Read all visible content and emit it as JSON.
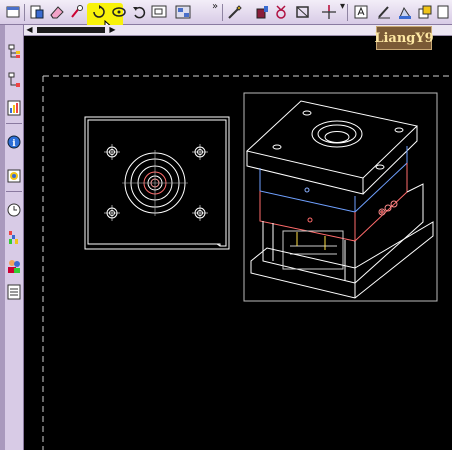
{
  "app": {
    "watermark_text": "LiangY9"
  },
  "toolbar": {
    "buttons": [
      {
        "icon": "new-file-icon"
      },
      {
        "icon": "open-file-icon"
      },
      {
        "icon": "erase-icon"
      },
      {
        "icon": "redraw-icon"
      },
      {
        "icon": "rotate-view-icon"
      },
      {
        "icon": "pan-view-icon"
      },
      {
        "icon": "undo-view-icon"
      },
      {
        "icon": "view-window-icon"
      },
      {
        "icon": "layout-icon"
      },
      {
        "icon": "pen-draw-icon"
      },
      {
        "icon": "paint-icon"
      },
      {
        "icon": "modify-icon"
      },
      {
        "icon": "frame-icon"
      },
      {
        "icon": "crosshair-icon"
      },
      {
        "icon": "text-edit-icon"
      },
      {
        "icon": "edit-pencil-icon"
      },
      {
        "icon": "stamp-icon"
      },
      {
        "icon": "copy-icon"
      }
    ],
    "highlight_color": "#f8f20a"
  },
  "sidebar": {
    "tools": [
      {
        "icon": "tree-icon"
      },
      {
        "icon": "hierarchy-icon"
      },
      {
        "icon": "chart-icon"
      },
      {
        "icon": "info-icon"
      },
      {
        "icon": "color-icon"
      },
      {
        "icon": "clock-icon"
      },
      {
        "icon": "palette-icon"
      },
      {
        "icon": "users-icon"
      },
      {
        "icon": "list-icon"
      }
    ]
  },
  "canvas": {
    "background": "#000000",
    "line_color": "#ffffff",
    "accent_colors": [
      "#6fa0ff",
      "#ff6b6b",
      "#ffe04a",
      "#8b0000"
    ]
  }
}
